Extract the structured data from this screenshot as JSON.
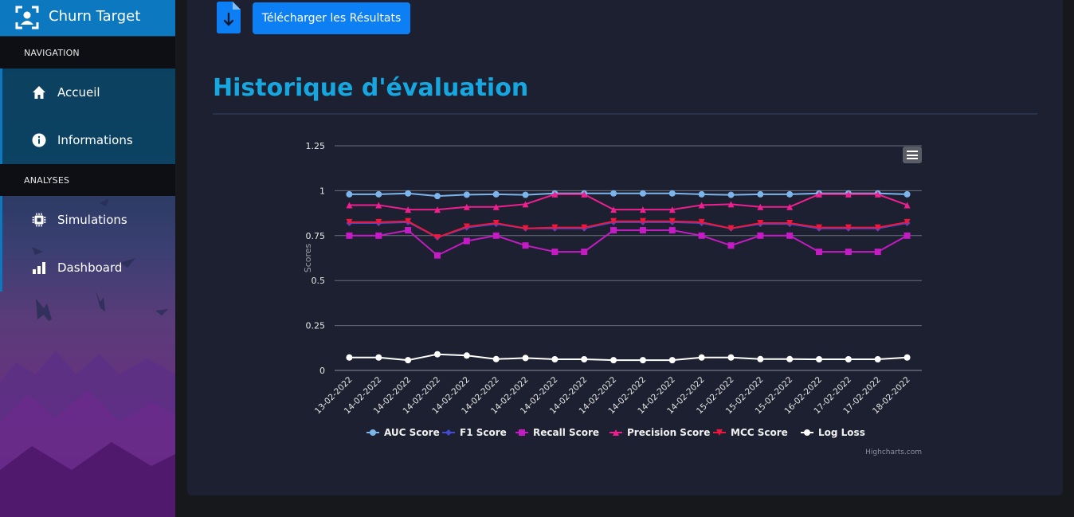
{
  "sidebar": {
    "brand": "Churn Target",
    "sections": [
      {
        "header": "NAVIGATION",
        "items": [
          {
            "label": "Accueil",
            "icon": "home-icon"
          },
          {
            "label": "Informations",
            "icon": "info-icon"
          }
        ]
      },
      {
        "header": "ANALYSES",
        "items": [
          {
            "label": "Simulations",
            "icon": "chip-icon"
          },
          {
            "label": "Dashboard",
            "icon": "bar-chart-icon"
          }
        ]
      }
    ]
  },
  "main": {
    "download_label": "Télécharger les Résultats",
    "section_title": "Historique d'évaluation"
  },
  "colors": {
    "accent": "#0b78bf",
    "title": "#16a7e0",
    "button": "#0d7ff5"
  },
  "chart_data": {
    "type": "line",
    "ylabel": "Scores",
    "ylim": [
      0,
      1.25
    ],
    "yticks": [
      0,
      0.25,
      0.5,
      0.75,
      1,
      1.25
    ],
    "categories": [
      "13-02-2022",
      "14-02-2022",
      "14-02-2022",
      "14-02-2022",
      "14-02-2022",
      "14-02-2022",
      "14-02-2022",
      "14-02-2022",
      "14-02-2022",
      "14-02-2022",
      "14-02-2022",
      "14-02-2022",
      "14-02-2022",
      "15-02-2022",
      "15-02-2022",
      "15-02-2022",
      "16-02-2022",
      "17-02-2022",
      "17-02-2022",
      "18-02-2022"
    ],
    "credit": "Highcharts.com",
    "series": [
      {
        "name": "AUC Score",
        "color": "#7cb5ec",
        "marker": "circle",
        "values": [
          0.98,
          0.98,
          0.985,
          0.97,
          0.978,
          0.98,
          0.977,
          0.985,
          0.985,
          0.985,
          0.985,
          0.985,
          0.98,
          0.977,
          0.98,
          0.98,
          0.985,
          0.985,
          0.985,
          0.98
        ]
      },
      {
        "name": "F1 Score",
        "color": "#434bd0",
        "marker": "diamond",
        "values": [
          0.82,
          0.82,
          0.825,
          0.74,
          0.795,
          0.815,
          0.79,
          0.79,
          0.79,
          0.825,
          0.825,
          0.825,
          0.82,
          0.79,
          0.815,
          0.815,
          0.79,
          0.79,
          0.79,
          0.82
        ]
      },
      {
        "name": "Recall Score",
        "color": "#c41bc4",
        "marker": "square",
        "values": [
          0.75,
          0.75,
          0.78,
          0.64,
          0.72,
          0.75,
          0.695,
          0.66,
          0.66,
          0.78,
          0.78,
          0.78,
          0.75,
          0.695,
          0.75,
          0.75,
          0.66,
          0.66,
          0.66,
          0.75
        ]
      },
      {
        "name": "Precision Score",
        "color": "#ee1f8f",
        "marker": "triangle",
        "values": [
          0.92,
          0.92,
          0.895,
          0.895,
          0.91,
          0.91,
          0.925,
          0.98,
          0.98,
          0.895,
          0.895,
          0.895,
          0.92,
          0.925,
          0.91,
          0.91,
          0.98,
          0.98,
          0.98,
          0.92
        ]
      },
      {
        "name": "MCC Score",
        "color": "#f0163c",
        "marker": "triangle-down",
        "values": [
          0.825,
          0.825,
          0.83,
          0.74,
          0.8,
          0.82,
          0.79,
          0.795,
          0.795,
          0.83,
          0.83,
          0.83,
          0.825,
          0.79,
          0.82,
          0.82,
          0.795,
          0.795,
          0.795,
          0.825
        ]
      },
      {
        "name": "Log Loss",
        "color": "#ffffff",
        "marker": "circle",
        "values": [
          0.072,
          0.072,
          0.057,
          0.09,
          0.083,
          0.063,
          0.069,
          0.062,
          0.062,
          0.057,
          0.057,
          0.057,
          0.072,
          0.072,
          0.063,
          0.063,
          0.062,
          0.062,
          0.062,
          0.072
        ]
      }
    ]
  }
}
